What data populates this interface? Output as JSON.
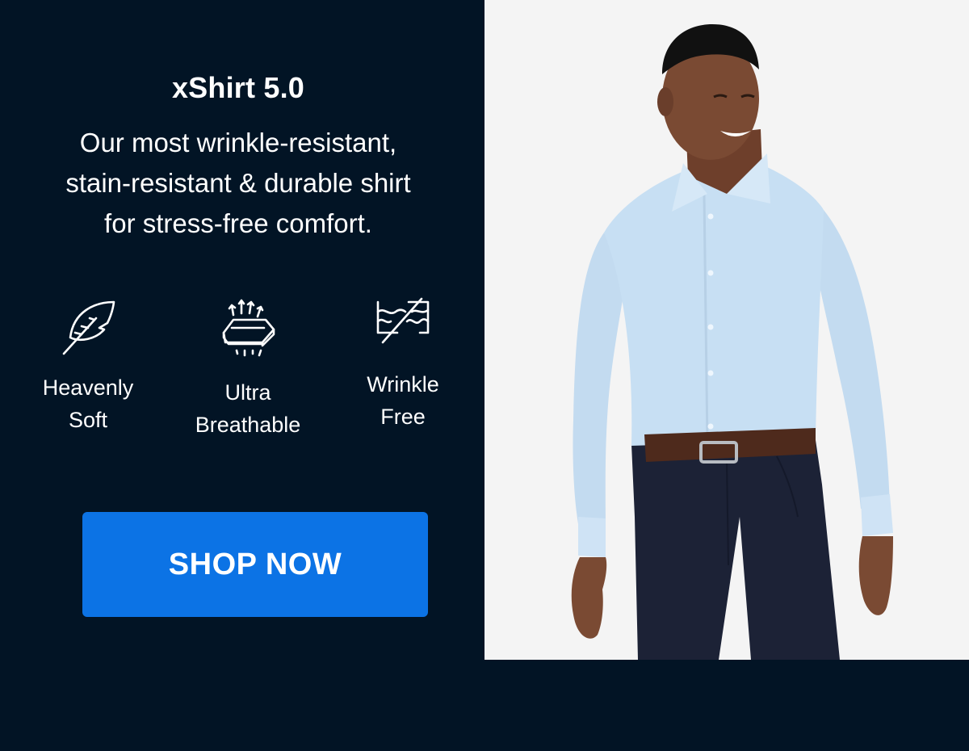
{
  "product": {
    "title": "xShirt 5.0",
    "description_lines": [
      "Our most wrinkle-resistant,",
      "stain-resistant & durable shirt",
      "for stress-free comfort."
    ]
  },
  "features": [
    {
      "icon": "feather-icon",
      "label_lines": [
        "Heavenly",
        "Soft"
      ]
    },
    {
      "icon": "breathable-fabric-icon",
      "label_lines": [
        "Ultra",
        "Breathable"
      ]
    },
    {
      "icon": "wrinkle-free-icon",
      "label_lines": [
        "Wrinkle",
        "Free"
      ]
    }
  ],
  "cta": {
    "label": "SHOP NOW"
  },
  "colors": {
    "background": "#021425",
    "button": "#0c73e5",
    "photo_background": "#f4f4f4",
    "shirt": "#c7dff3",
    "pants": "#1c2236"
  }
}
